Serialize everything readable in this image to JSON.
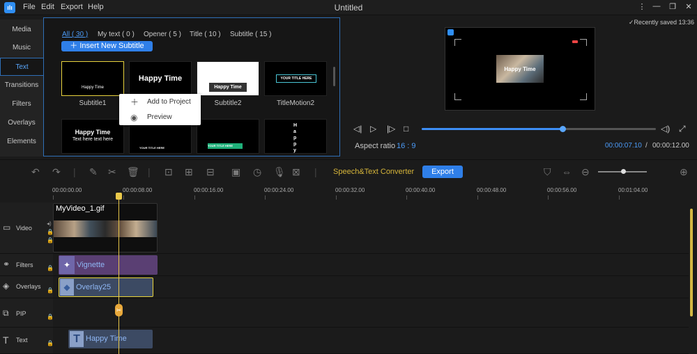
{
  "app": {
    "title": "Untitled",
    "menu": [
      "File",
      "Edit",
      "Export",
      "Help"
    ],
    "window_controls": [
      "⋮",
      "—",
      "❐",
      "✕"
    ],
    "logo_glyph": "ılı"
  },
  "left_tabs": [
    "Media",
    "Music",
    "Text",
    "Transitions",
    "Filters",
    "Overlays",
    "Elements"
  ],
  "library": {
    "filters": [
      "All ( 30 )",
      "My text ( 0 )",
      "Opener ( 5 )",
      "Title ( 10 )",
      "Subtitle ( 15 )"
    ],
    "insert_button": "Insert New Subtitle",
    "thumbnails": [
      {
        "caption": "Subtitle1",
        "text": "Happy Time"
      },
      {
        "caption": "",
        "text": "Happy Time"
      },
      {
        "caption": "Subtitle2",
        "text": "Happy Time"
      },
      {
        "caption": "TitleMotion2",
        "text": "YOUR TITLE HERE"
      },
      {
        "caption": "",
        "text": "Happy Time",
        "sub": "Text here text here"
      },
      {
        "caption": "",
        "text": "YOUR TITLE HERE"
      },
      {
        "caption": "",
        "text": "YOUR TITLE HERE"
      },
      {
        "caption": "",
        "text": "Happy"
      }
    ],
    "context_menu": [
      "Add to Project",
      "Preview"
    ]
  },
  "preview": {
    "saved_status": "Recently saved 13:36",
    "overlay_title": "Happy Time",
    "aspect_label": "Aspect ratio",
    "aspect_value": "16 : 9",
    "time_current": "00:00:07.10",
    "time_separator": "/",
    "time_total": "00:00:12.00",
    "progress": 0.6
  },
  "toolbar": {
    "speech_text": "Speech&Text Converter",
    "export_label": "Export"
  },
  "ruler": [
    "00:00:00.00",
    "00:00:08.00",
    "00:00:16.00",
    "00:00:24.00",
    "00:00:32.00",
    "00:00:40.00",
    "00:00:48.00",
    "00:00:56.00",
    "00:01:04.00"
  ],
  "tracks": [
    {
      "name": "Video",
      "clip": "MyVideo_1.gif"
    },
    {
      "name": "Filters",
      "clip": "Vignette"
    },
    {
      "name": "Overlays",
      "clip": "Overlay25"
    },
    {
      "name": "PIP",
      "clip": ""
    },
    {
      "name": "Text",
      "clip": "Happy Time"
    }
  ],
  "colors": {
    "accent": "#2f7fe8",
    "playhead": "#e9c84a",
    "filter_clip": "#5a3f73",
    "overlay_clip": "#3c4a63",
    "text_clip": "#3c4a63"
  }
}
